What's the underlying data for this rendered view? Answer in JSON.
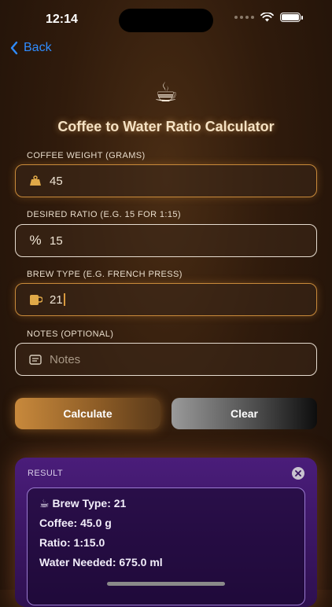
{
  "status_bar": {
    "time": "12:14"
  },
  "nav": {
    "back_label": "Back"
  },
  "header": {
    "icon": "coffee-cup-icon",
    "title": "Coffee to Water Ratio Calculator"
  },
  "fields": {
    "coffee_weight": {
      "label": "COFFEE WEIGHT (GRAMS)",
      "value": "45"
    },
    "ratio": {
      "label": "DESIRED RATIO (E.G. 15 FOR 1:15)",
      "value": "15"
    },
    "brew_type": {
      "label": "BREW TYPE (E.G. FRENCH PRESS)",
      "value": "21"
    },
    "notes": {
      "label": "NOTES (OPTIONAL)",
      "placeholder": "Notes"
    }
  },
  "buttons": {
    "calculate": "Calculate",
    "clear": "Clear"
  },
  "result": {
    "label": "RESULT",
    "lines": [
      "☕ Brew Type: 21",
      "Coffee: 45.0 g",
      "Ratio: 1:15.0",
      "Water Needed: 675.0 ml"
    ]
  },
  "colors": {
    "accent": "#c8893c",
    "link": "#2f8cff",
    "result_bg": "#3a1562"
  }
}
